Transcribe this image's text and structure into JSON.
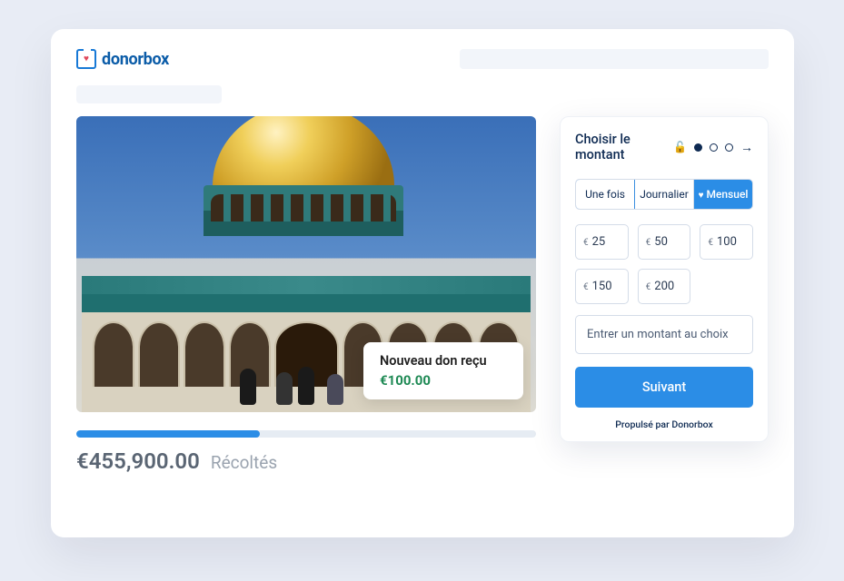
{
  "brand": {
    "name": "donorbox"
  },
  "toast": {
    "title": "Nouveau don reçu",
    "amount": "€100.00"
  },
  "progress": {
    "raised_amount": "€455,900.00",
    "raised_label": "Récoltés",
    "percent": 40
  },
  "widget": {
    "title": "Choisir le montant",
    "frequency": {
      "once": "Une fois",
      "daily": "Journalier",
      "monthly": "Mensuel"
    },
    "currency": "€",
    "amounts": [
      "25",
      "50",
      "100",
      "150",
      "200"
    ],
    "custom_placeholder": "Entrer un montant au choix",
    "next_label": "Suivant",
    "powered": "Propulsé par Donorbox"
  }
}
